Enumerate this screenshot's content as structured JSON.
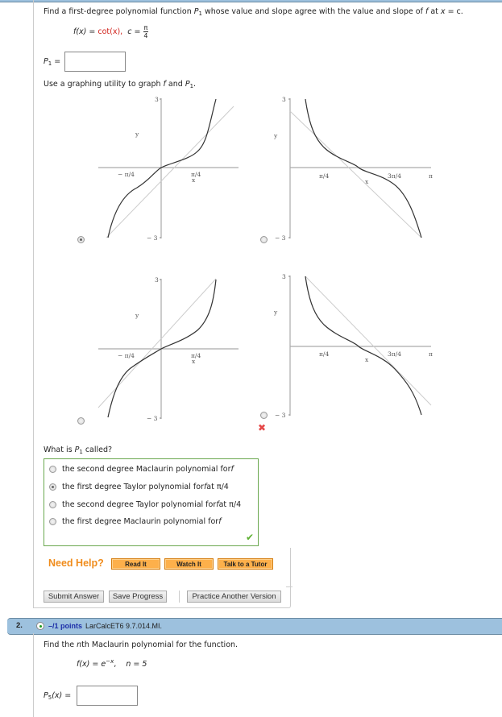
{
  "question1": {
    "prompt_parts": [
      "Find a first-degree polynomial function ",
      "P",
      "1",
      " whose value and slope agree with the value and slope of ",
      "f",
      " at ",
      "x",
      " = c."
    ],
    "function_lhs": "f(x) =",
    "function_rhs": "cot(x),",
    "c_label": "c =",
    "c_num": "π",
    "c_den": "4",
    "answer_label_P": "P",
    "answer_label_sub": "1",
    "answer_label_eq": " =",
    "answer_value": "",
    "graph_prompt_parts": [
      "Use a graphing utility to graph ",
      "f",
      " and ",
      "P",
      "1",
      "."
    ],
    "graph_options": [
      {
        "selected": true,
        "wrong_mark": false,
        "kind": "odd",
        "line": "tangent-right"
      },
      {
        "selected": false,
        "wrong_mark": false,
        "kind": "cot",
        "line": "tangent-left"
      },
      {
        "selected": false,
        "wrong_mark": false,
        "kind": "odd",
        "line": "secant-up"
      },
      {
        "selected": false,
        "wrong_mark": true,
        "kind": "cot",
        "line": "tangent-right"
      }
    ],
    "graph_labels": {
      "y_top": "3",
      "y_bottom": "− 3",
      "y_axis": "y",
      "x_axis": "x",
      "neg_pi4": "− π/4",
      "pi4": "π/4",
      "three_pi4": "3π/4",
      "pi": "π"
    },
    "mc_prompt_parts": [
      "What is ",
      "P",
      "1",
      " called?"
    ],
    "mc_options": [
      {
        "label_parts": [
          "the second degree Maclaurin polynomial for ",
          "f",
          ""
        ],
        "selected": false
      },
      {
        "label_parts": [
          "the first degree Taylor polynomial for ",
          "f",
          " at π/4"
        ],
        "selected": true
      },
      {
        "label_parts": [
          "the second degree Taylor polynomial for ",
          "f",
          " at π/4"
        ],
        "selected": false
      },
      {
        "label_parts": [
          "the first degree Maclaurin polynomial for ",
          "f",
          ""
        ],
        "selected": false
      }
    ],
    "mc_status": "correct",
    "mc_status_icon": "✔"
  },
  "help": {
    "label": "Need Help?",
    "buttons": [
      "Read It",
      "Watch It",
      "Talk to a Tutor"
    ]
  },
  "actions": {
    "submit": "Submit Answer",
    "save": "Save Progress",
    "practice": "Practice Another Version"
  },
  "question2": {
    "number": "2.",
    "points": "–/1 points",
    "source": "LarCalcET6 9.7.014.MI.",
    "prompt_parts": [
      "Find the ",
      "n",
      "th Maclaurin polynomial for the function."
    ],
    "function": "f(x) = e",
    "exponent": "−x",
    "comma": ",",
    "n_label": "n = 5",
    "answer_label_P": "P",
    "answer_label_sub": "5",
    "answer_label_rest": "(x) =",
    "answer_value": ""
  },
  "colors": {
    "header_bar": "#9dc1de",
    "help_orange": "#f08c1c",
    "help_button": "#fdb04b",
    "correct_green": "#5cb031",
    "wrong_red": "#e54848",
    "points_blue": "#1c2ea8",
    "function_red": "#d0201a"
  }
}
